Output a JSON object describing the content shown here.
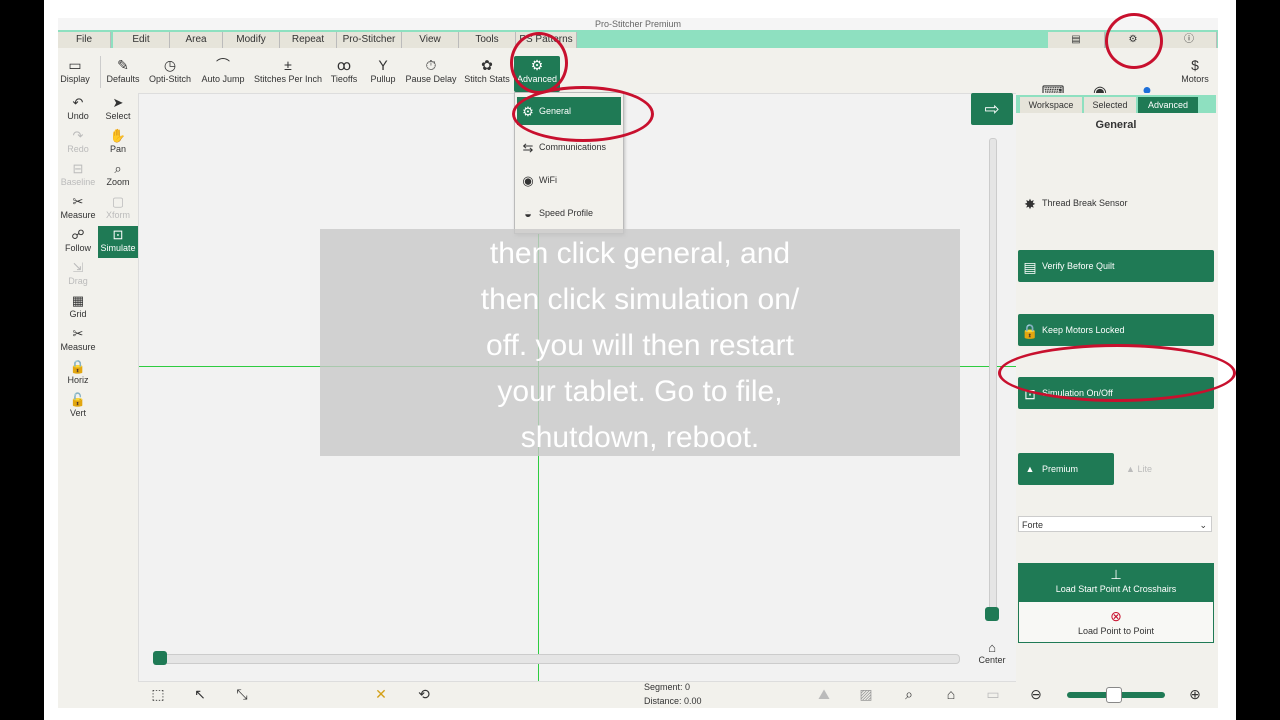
{
  "window": {
    "title": "Pro-Stitcher Premium"
  },
  "menu": [
    "File",
    "Edit",
    "Area",
    "Modify",
    "Repeat",
    "Pro-Stitcher",
    "View",
    "Tools",
    "PS Patterns"
  ],
  "toolbar": [
    {
      "label": "Display",
      "icon": "display-icon"
    },
    {
      "label": "Defaults",
      "icon": "defaults-icon"
    },
    {
      "label": "Opti-Stitch",
      "icon": "opti-stitch-icon"
    },
    {
      "label": "Auto Jump",
      "icon": "auto-jump-icon"
    },
    {
      "label": "Stitches Per Inch",
      "icon": "stitches-per-inch-icon"
    },
    {
      "label": "Tieoffs",
      "icon": "tieoffs-icon"
    },
    {
      "label": "Pullup",
      "icon": "pullup-icon"
    },
    {
      "label": "Pause Delay",
      "icon": "pause-delay-icon"
    },
    {
      "label": "Stitch Stats",
      "icon": "stitch-stats-icon"
    },
    {
      "label": "Advanced",
      "icon": "advanced-icon"
    }
  ],
  "left_tools": [
    {
      "label": "Undo",
      "state": "enabled"
    },
    {
      "label": "Select",
      "state": "enabled"
    },
    {
      "label": "Redo",
      "state": "disabled"
    },
    {
      "label": "Pan",
      "state": "enabled"
    },
    {
      "label": "Baseline",
      "state": "disabled"
    },
    {
      "label": "Zoom",
      "state": "enabled"
    },
    {
      "label": "Measure",
      "state": "enabled"
    },
    {
      "label": "Xform",
      "state": "disabled"
    },
    {
      "label": "Follow",
      "state": "enabled"
    },
    {
      "label": "Simulate",
      "state": "active"
    },
    {
      "label": "Drag",
      "state": "disabled"
    },
    {
      "label": "Grid",
      "state": "enabled"
    },
    {
      "label": "Measure",
      "state": "enabled"
    },
    {
      "label": "Horiz",
      "state": "enabled"
    },
    {
      "label": "Vert",
      "state": "enabled"
    }
  ],
  "dropdown": [
    "General",
    "Communications",
    "WiFi",
    "Speed Profile"
  ],
  "right_panel": {
    "tabs": [
      "Workspace",
      "Selected",
      "Advanced"
    ],
    "title": "General",
    "options": [
      "Thread Break Sensor",
      "Verify Before Quilt",
      "Keep Motors Locked",
      "Simulation On/Off"
    ],
    "premium": "Premium",
    "lite": "Lite",
    "machine": "Forte",
    "load_start": "Load Start Point At Crosshairs",
    "load_point": "Load Point to Point",
    "motors": "Motors",
    "center": "Center"
  },
  "status": {
    "segment_label": "Segment:",
    "segment_value": "0",
    "distance_label": "Distance:",
    "distance_value": "0.00"
  },
  "caption": {
    "lines": [
      "then click general, and",
      "then click simulation on/",
      "off. you will then restart",
      "your tablet. Go to file,",
      "shutdown, reboot."
    ]
  },
  "colors": {
    "accent": "#1f7a55",
    "menu_bg": "#8ee0c0",
    "highlight_ring": "#c8102e",
    "guide_line": "#2ecc40"
  }
}
